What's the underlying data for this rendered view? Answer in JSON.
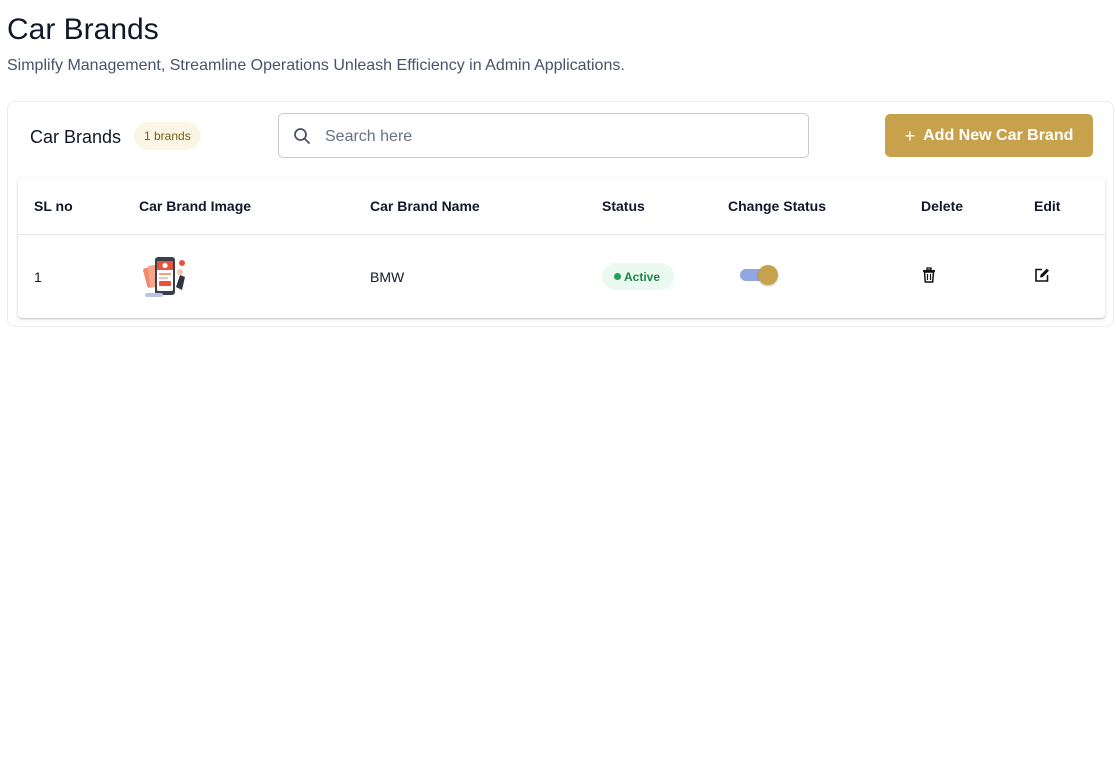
{
  "page": {
    "title": "Car Brands",
    "subtitle": "Simplify Management, Streamline Operations Unleash Efficiency in Admin Applications."
  },
  "toolbar": {
    "title": "Car Brands",
    "count_badge": "1 brands",
    "search_placeholder": "Search here",
    "search_value": "",
    "add_button_label": "Add New Car Brand",
    "add_button_icon": "plus-icon",
    "accent_color": "#c7a14b"
  },
  "table": {
    "columns": [
      "SL no",
      "Car Brand Image",
      "Car Brand Name",
      "Status",
      "Change Status",
      "Delete",
      "Edit"
    ],
    "rows": [
      {
        "sl_no": "1",
        "image_icon": "brand-thumbnail-illustration",
        "name": "BMW",
        "status": "Active",
        "status_color": "#1e8449",
        "toggle_on": true,
        "delete_icon": "trash-icon",
        "edit_icon": "edit-icon"
      }
    ]
  }
}
